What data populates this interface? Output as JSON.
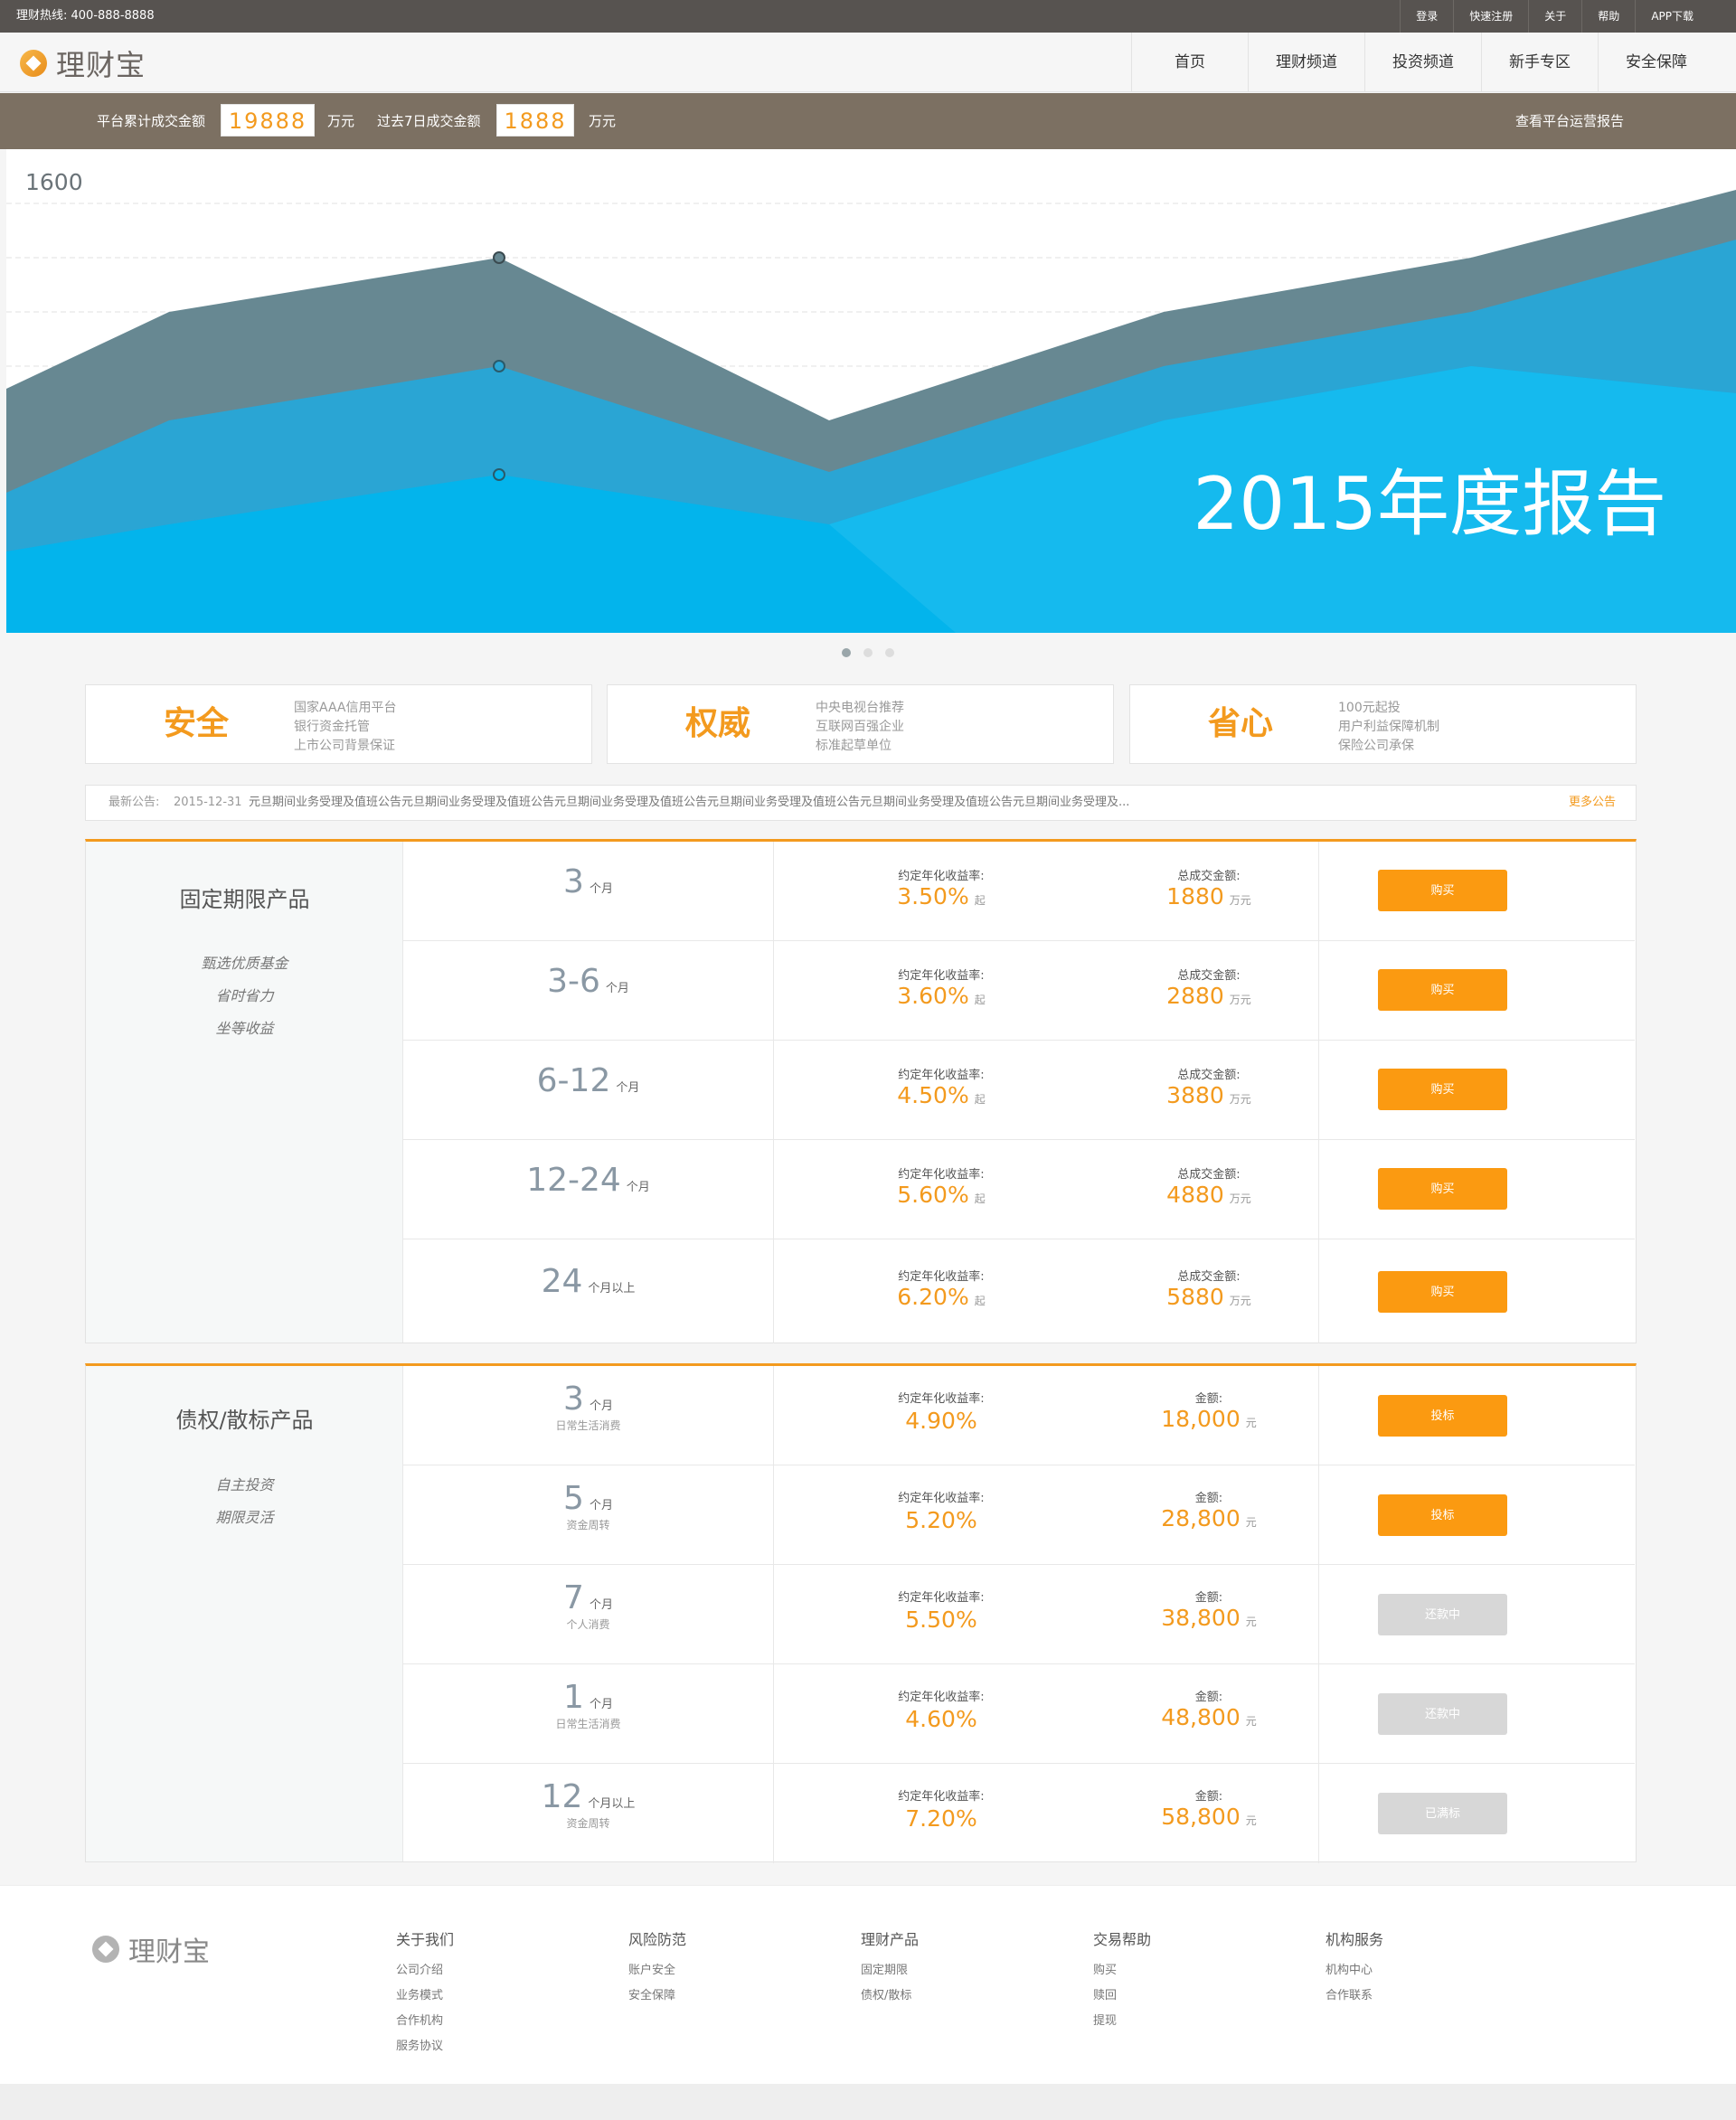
{
  "topbar": {
    "hotline": "理财热线: 400-888-8888",
    "links": [
      "登录",
      "快速注册",
      "关于",
      "帮助",
      "APP下载"
    ]
  },
  "header": {
    "logo_text": "理财宝",
    "nav": [
      "首页",
      "理财频道",
      "投资频道",
      "新手专区",
      "安全保障"
    ]
  },
  "stats": {
    "total_label": "平台累计成交金额",
    "total_value": "19888",
    "total_unit": "万元",
    "week_label": "过去7日成交金额",
    "week_value": "1888",
    "week_unit": "万元",
    "report_link": "查看平台运营报告"
  },
  "banner": {
    "y_tick": "1600",
    "headline": "2015年度报告",
    "accent_colors": [
      "#678892",
      "#2aa5d4",
      "#03b4ec"
    ]
  },
  "features": [
    {
      "title": "安全",
      "lines": [
        "国家AAA信用平台",
        "银行资金托管",
        "上市公司背景保证"
      ]
    },
    {
      "title": "权威",
      "lines": [
        "中央电视台推荐",
        "互联网百强企业",
        "标准起草单位"
      ]
    },
    {
      "title": "省心",
      "lines": [
        "100元起投",
        "用户利益保障机制",
        "保险公司承保"
      ]
    }
  ],
  "notice": {
    "label": "最新公告:",
    "date": "2015-12-31",
    "message": "元旦期间业务受理及值班公告元旦期间业务受理及值班公告元旦期间业务受理及值班公告元旦期间业务受理及值班公告元旦期间业务受理及值班公告元旦期间业务受理及...",
    "more": "更多公告"
  },
  "fixed": {
    "title": "固定期限产品",
    "subs": [
      "甄选优质基金",
      "省时省力",
      "坐等收益"
    ],
    "rate_label": "约定年化收益率:",
    "amount_label": "总成交金额:",
    "rate_suffix": "起",
    "amount_unit": "万元",
    "rows": [
      {
        "term": "3",
        "unit": "个月",
        "rate": "3.50%",
        "amount": "1880",
        "button": "购买"
      },
      {
        "term": "3-6",
        "unit": "个月",
        "rate": "3.60%",
        "amount": "2880",
        "button": "购买"
      },
      {
        "term": "6-12",
        "unit": "个月",
        "rate": "4.50%",
        "amount": "3880",
        "button": "购买"
      },
      {
        "term": "12-24",
        "unit": "个月",
        "rate": "5.60%",
        "amount": "4880",
        "button": "购买"
      },
      {
        "term": "24",
        "unit": "个月以上",
        "rate": "6.20%",
        "amount": "5880",
        "button": "购买"
      }
    ]
  },
  "debt": {
    "title": "债权/散标产品",
    "subs": [
      "自主投资",
      "期限灵活"
    ],
    "rate_label": "约定年化收益率:",
    "amount_label": "金额:",
    "amount_unit": "元",
    "rows": [
      {
        "term": "3",
        "unit": "个月",
        "purpose": "日常生活消费",
        "rate": "4.90%",
        "amount": "18,000",
        "button": "投标",
        "state": "active"
      },
      {
        "term": "5",
        "unit": "个月",
        "purpose": "资金周转",
        "rate": "5.20%",
        "amount": "28,800",
        "button": "投标",
        "state": "active"
      },
      {
        "term": "7",
        "unit": "个月",
        "purpose": "个人消费",
        "rate": "5.50%",
        "amount": "38,800",
        "button": "还款中",
        "state": "disabled"
      },
      {
        "term": "1",
        "unit": "个月",
        "purpose": "日常生活消费",
        "rate": "4.60%",
        "amount": "48,800",
        "button": "还款中",
        "state": "disabled"
      },
      {
        "term": "12",
        "unit": "个月以上",
        "purpose": "资金周转",
        "rate": "7.20%",
        "amount": "58,800",
        "button": "已满标",
        "state": "disabled"
      }
    ]
  },
  "footer": {
    "logo_text": "理财宝",
    "columns": [
      {
        "title": "关于我们",
        "links": [
          "公司介绍",
          "业务模式",
          "合作机构",
          "服务协议"
        ]
      },
      {
        "title": "风险防范",
        "links": [
          "账户安全",
          "安全保障"
        ]
      },
      {
        "title": "理财产品",
        "links": [
          "固定期限",
          "债权/散标"
        ]
      },
      {
        "title": "交易帮助",
        "links": [
          "购买",
          "赎回",
          "提现"
        ]
      },
      {
        "title": "机构服务",
        "links": [
          "机构中心",
          "合作联系"
        ]
      }
    ]
  }
}
